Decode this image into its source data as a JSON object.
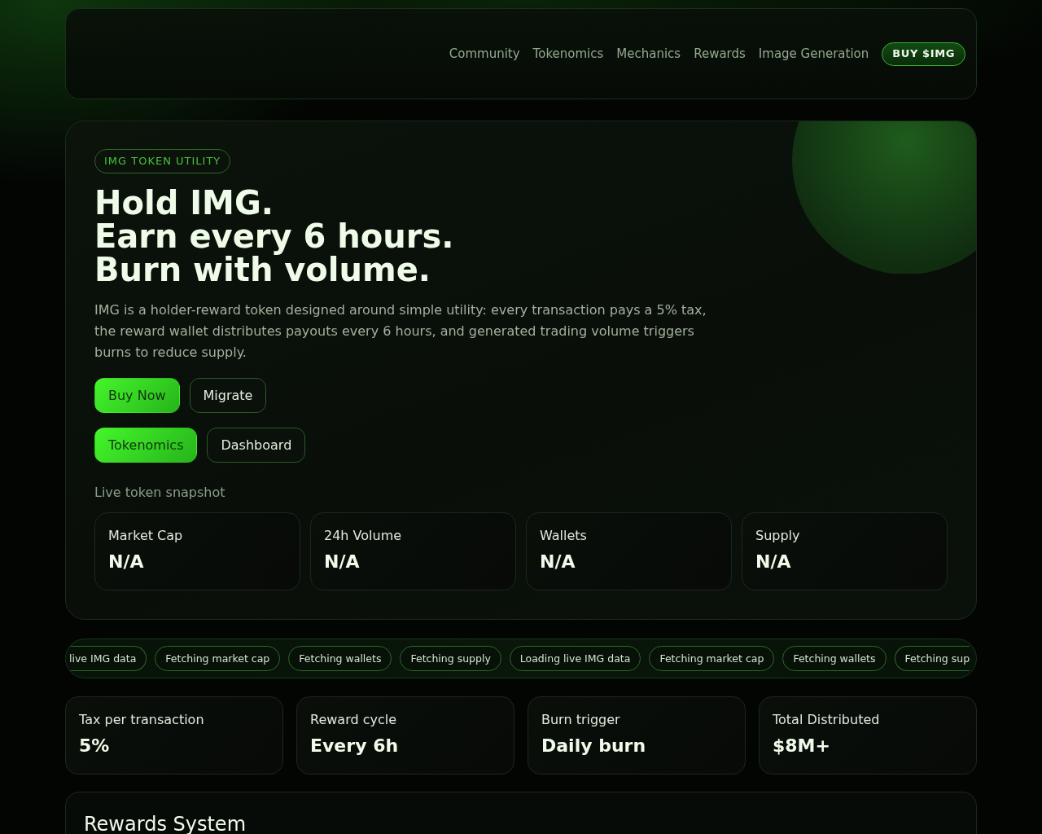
{
  "header": {
    "nav": [
      "Community",
      "Tokenomics",
      "Mechanics",
      "Rewards",
      "Image Generation"
    ],
    "cta": "BUY $IMG"
  },
  "hero": {
    "badge": "IMG TOKEN UTILITY",
    "heading": [
      "Hold IMG.",
      "Earn every 6 hours.",
      "Burn with volume."
    ],
    "description": "IMG is a holder-reward token designed around simple utility: every transaction pays a 5% tax, the reward wallet distributes payouts every 6 hours, and generated trading volume triggers burns to reduce supply.",
    "button_rows": [
      [
        {
          "label": "Buy Now",
          "kind": "primary"
        },
        {
          "label": "Migrate",
          "kind": "secondary"
        }
      ],
      [
        {
          "label": "Tokenomics",
          "kind": "primary"
        },
        {
          "label": "Dashboard",
          "kind": "secondary"
        }
      ]
    ],
    "snapshot_title": "Live token snapshot",
    "snapshot": [
      {
        "label": "Market Cap",
        "value": "N/A"
      },
      {
        "label": "24h Volume",
        "value": "N/A"
      },
      {
        "label": "Wallets",
        "value": "N/A"
      },
      {
        "label": "Supply",
        "value": "N/A"
      }
    ]
  },
  "ticker": [
    "live IMG data",
    "Fetching market cap",
    "Fetching wallets",
    "Fetching supply",
    "Loading live IMG data",
    "Fetching market cap",
    "Fetching wallets",
    "Fetching sup"
  ],
  "stats": [
    {
      "label": "Tax per transaction",
      "value": "5%"
    },
    {
      "label": "Reward cycle",
      "value": "Every 6h"
    },
    {
      "label": "Burn trigger",
      "value": "Daily burn"
    },
    {
      "label": "Total Distributed",
      "value": "$8M+"
    }
  ],
  "rewards": {
    "title": "Rewards System"
  }
}
